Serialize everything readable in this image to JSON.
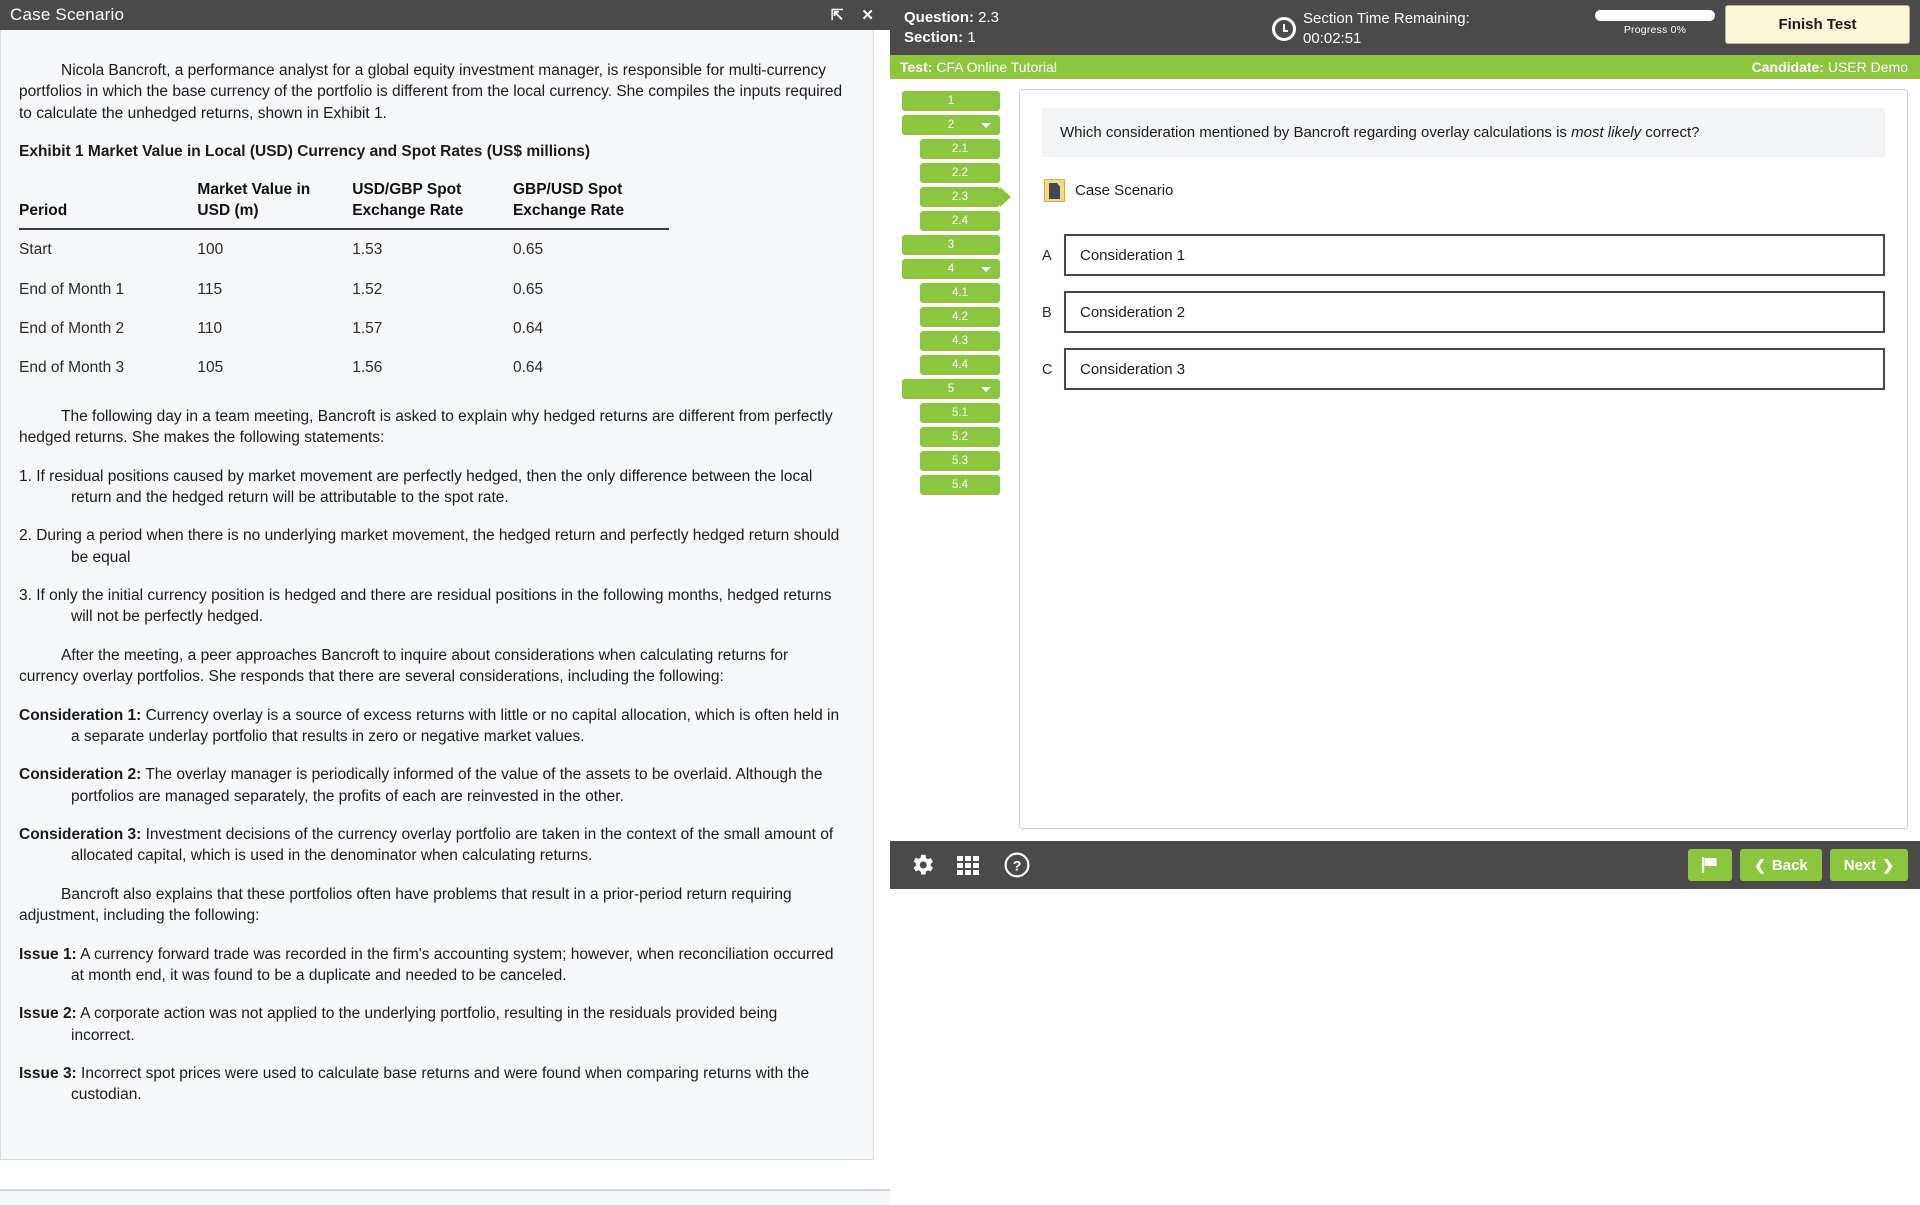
{
  "case_window": {
    "title": "Case Scenario",
    "restore_icon": "restore-icon",
    "close_icon": "close-icon",
    "intro_paragraph": "Nicola Bancroft, a performance analyst for a global equity investment manager, is responsible for multi-currency portfolios in which the base currency of the portfolio is different from the local currency. She compiles the inputs required to calculate the unhedged returns, shown in Exhibit 1.",
    "exhibit_title": "Exhibit 1 Market Value in Local (USD) Currency and Spot Rates (US$ millions)",
    "exhibit_table": {
      "headers": [
        "Period",
        "Market Value in USD (m)",
        "USD/GBP Spot Exchange Rate",
        "GBP/USD Spot Exchange Rate"
      ],
      "rows": [
        [
          "Start",
          "100",
          "1.53",
          "0.65"
        ],
        [
          "End of Month 1",
          "115",
          "1.52",
          "0.65"
        ],
        [
          "End of Month 2",
          "110",
          "1.57",
          "0.64"
        ],
        [
          "End of Month 3",
          "105",
          "1.56",
          "0.64"
        ]
      ]
    },
    "meeting_paragraph": "The following day in a team meeting, Bancroft is asked to explain why hedged returns are different from perfectly hedged returns. She makes the following statements:",
    "statements": [
      "1. If residual positions caused by market movement are perfectly hedged, then the only difference between the local return and the hedged return will be attributable to the spot rate.",
      "2. During a period when there is no underlying market movement, the hedged return and perfectly hedged return should be equal",
      "3. If only the initial currency position is hedged and there are residual positions in the following months, hedged returns will not be perfectly hedged."
    ],
    "peer_paragraph": "After the meeting, a peer approaches Bancroft to inquire about considerations when calculating returns for currency overlay portfolios. She responds that there are several considerations, including the following:",
    "considerations": [
      {
        "label": "Consideration 1:",
        "text": " Currency overlay is a source of excess returns with little or no capital allocation, which is often held in a separate underlay portfolio that results in zero or negative market values."
      },
      {
        "label": "Consideration 2:",
        "text": " The overlay manager is periodically informed of the value of the assets to be overlaid. Although the portfolios are managed separately, the profits of each are reinvested in the other."
      },
      {
        "label": "Consideration 3:",
        "text": " Investment decisions of the currency overlay portfolio are taken in the context of the small amount of allocated capital, which is used in the denominator when calculating returns."
      }
    ],
    "problems_paragraph": "Bancroft also explains that these portfolios often have problems that result in a prior-period return requiring adjustment, including the following:",
    "issues": [
      {
        "label": "Issue 1:",
        "text": " A currency forward trade was recorded in the firm's accounting system; however, when reconciliation occurred at month end, it was found to be a duplicate and needed to be canceled."
      },
      {
        "label": "Issue 2:",
        "text": " A corporate action was not applied to the underlying portfolio, resulting in the residuals provided being incorrect."
      },
      {
        "label": "Issue 3:",
        "text": " Incorrect spot prices were used to calculate base returns and were found when comparing returns with the custodian."
      }
    ]
  },
  "exam": {
    "topbar": {
      "question_label": "Question:",
      "question_value": "2.3",
      "section_label": "Section:",
      "section_value": "1",
      "clock_icon": "clock-icon",
      "timer_label": "Section Time Remaining:",
      "timer_value": "00:02:51",
      "progress_label": "Progress 0%",
      "progress_percent": 0,
      "finish_button": "Finish Test"
    },
    "subbar": {
      "test_label": "Test:",
      "test_name": "CFA Online Tutorial",
      "candidate_label": "Candidate:",
      "candidate_name": "USER Demo"
    },
    "question_nav": [
      {
        "label": "1",
        "sub": false,
        "caret": false,
        "current": false
      },
      {
        "label": "2",
        "sub": false,
        "caret": true,
        "current": false
      },
      {
        "label": "2.1",
        "sub": true,
        "caret": false,
        "current": false
      },
      {
        "label": "2.2",
        "sub": true,
        "caret": false,
        "current": false
      },
      {
        "label": "2.3",
        "sub": true,
        "caret": false,
        "current": true
      },
      {
        "label": "2.4",
        "sub": true,
        "caret": false,
        "current": false
      },
      {
        "label": "3",
        "sub": false,
        "caret": false,
        "current": false
      },
      {
        "label": "4",
        "sub": false,
        "caret": true,
        "current": false
      },
      {
        "label": "4.1",
        "sub": true,
        "caret": false,
        "current": false
      },
      {
        "label": "4.2",
        "sub": true,
        "caret": false,
        "current": false
      },
      {
        "label": "4.3",
        "sub": true,
        "caret": false,
        "current": false
      },
      {
        "label": "4.4",
        "sub": true,
        "caret": false,
        "current": false
      },
      {
        "label": "5",
        "sub": false,
        "caret": true,
        "current": false
      },
      {
        "label": "5.1",
        "sub": true,
        "caret": false,
        "current": false
      },
      {
        "label": "5.2",
        "sub": true,
        "caret": false,
        "current": false
      },
      {
        "label": "5.3",
        "sub": true,
        "caret": false,
        "current": false
      },
      {
        "label": "5.4",
        "sub": true,
        "caret": false,
        "current": false
      }
    ],
    "question": {
      "stem_before_italic": "Which consideration mentioned by Bancroft regarding overlay calculations is ",
      "stem_italic": "most likely",
      "stem_after_italic": " correct?",
      "case_link_label": "Case Scenario",
      "case_link_icon": "document-icon",
      "answers": [
        {
          "letter": "A",
          "text": "Consideration 1"
        },
        {
          "letter": "B",
          "text": "Consideration 2"
        },
        {
          "letter": "C",
          "text": "Consideration 3"
        }
      ]
    },
    "bottombar": {
      "settings_icon": "gear-icon",
      "grid_icon": "grid-icon",
      "help_icon": "help-icon",
      "flag_icon": "flag-icon",
      "back_button": "Back",
      "next_button": "Next",
      "back_chevron": "❮",
      "next_chevron": "❯"
    }
  },
  "colors": {
    "accent_green": "#8cc63e",
    "dark_chrome": "#4a4a4a",
    "panel_bg": "#f6f7f9",
    "finish_yellow": "#faf6d8"
  }
}
